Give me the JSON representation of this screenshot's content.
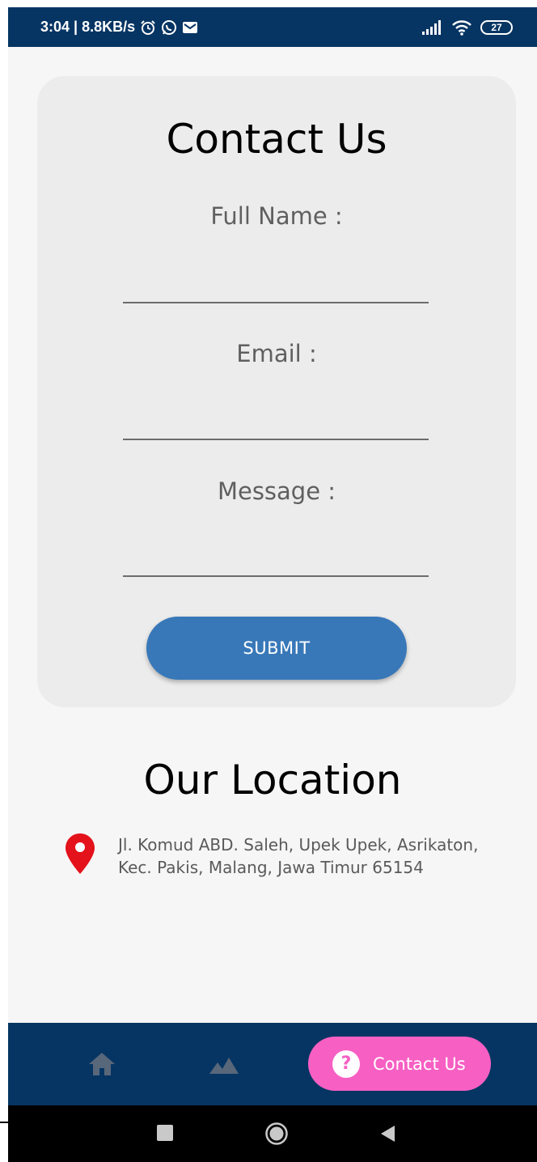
{
  "status_bar": {
    "time_speed": "3:04 | 8.8KB/s",
    "battery_level": "27",
    "icons": [
      "alarm-icon",
      "whatsapp-icon",
      "gmail-icon",
      "signal-icon",
      "wifi-icon",
      "battery-icon"
    ]
  },
  "contact_form": {
    "title": "Contact Us",
    "full_name_label": "Full Name :",
    "full_name_value": "",
    "email_label": "Email :",
    "email_value": "",
    "message_label": "Message :",
    "message_value": "",
    "submit_label": "SUBMIT"
  },
  "location": {
    "title": "Our Location",
    "address_line1": "Jl. Komud ABD. Saleh, Upek Upek, Asrikaton,",
    "address_line2": "Kec. Pakis, Malang, Jawa Timur 65154",
    "pin_icon": "map-pin-icon"
  },
  "bottom_nav": {
    "items": [
      {
        "icon": "home-icon",
        "label": ""
      },
      {
        "icon": "landscape-icon",
        "label": ""
      },
      {
        "icon": "help-icon",
        "label": "Contact Us",
        "active": true
      }
    ]
  },
  "colors": {
    "primary_dark": "#063563",
    "submit_blue": "#3878b8",
    "active_pink": "#f75fc3",
    "pin_red": "#e3121b",
    "card_bg": "#ececec",
    "screen_bg": "#f6f6f6"
  }
}
